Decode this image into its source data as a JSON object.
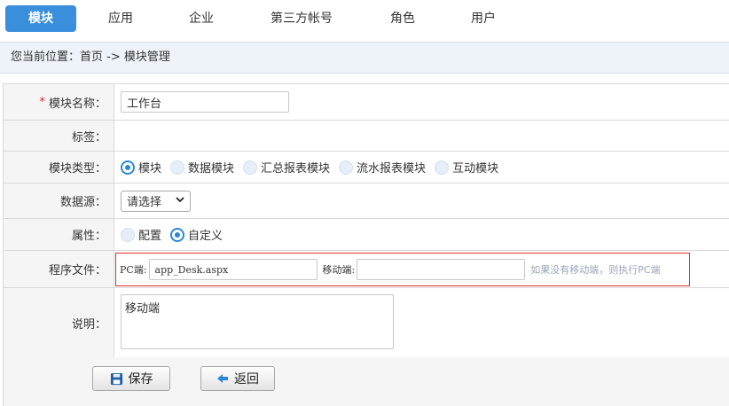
{
  "nav": {
    "items": [
      {
        "label": "模块",
        "active": true
      },
      {
        "label": "应用",
        "active": false
      },
      {
        "label": "企业",
        "active": false
      },
      {
        "label": "第三方帐号",
        "active": false
      },
      {
        "label": "角色",
        "active": false
      },
      {
        "label": "用户",
        "active": false
      }
    ]
  },
  "breadcrumb": {
    "prefix": "您当前位置：",
    "home": "首页",
    "separator": " -> ",
    "current": "模块管理"
  },
  "form": {
    "name": {
      "required_mark": "*",
      "label": "模块名称：",
      "value": "工作台"
    },
    "tags": {
      "label": "标签："
    },
    "type": {
      "label": "模块类型：",
      "options": [
        {
          "label": "模块",
          "checked": true
        },
        {
          "label": "数据模块",
          "checked": false
        },
        {
          "label": "汇总报表模块",
          "checked": false
        },
        {
          "label": "流水报表模块",
          "checked": false
        },
        {
          "label": "互动模块",
          "checked": false
        }
      ]
    },
    "datasource": {
      "label": "数据源：",
      "selected": "请选择"
    },
    "attribute": {
      "label": "属性：",
      "options": [
        {
          "label": "配置",
          "checked": false
        },
        {
          "label": "自定义",
          "checked": true
        }
      ]
    },
    "program": {
      "label": "程序文件：",
      "pc_label": "PC端:",
      "pc_value": "app_Desk.aspx",
      "mobile_label": "移动端:",
      "mobile_value": "",
      "hint": "如果没有移动端，则执行PC端"
    },
    "description": {
      "label": "说明：",
      "value": "移动端"
    }
  },
  "buttons": {
    "save": "保存",
    "back": "返回"
  },
  "colors": {
    "accent": "#3a8fdc",
    "radio": "#2b88d8",
    "required": "#e02020",
    "highlight_border": "#e0302b"
  }
}
